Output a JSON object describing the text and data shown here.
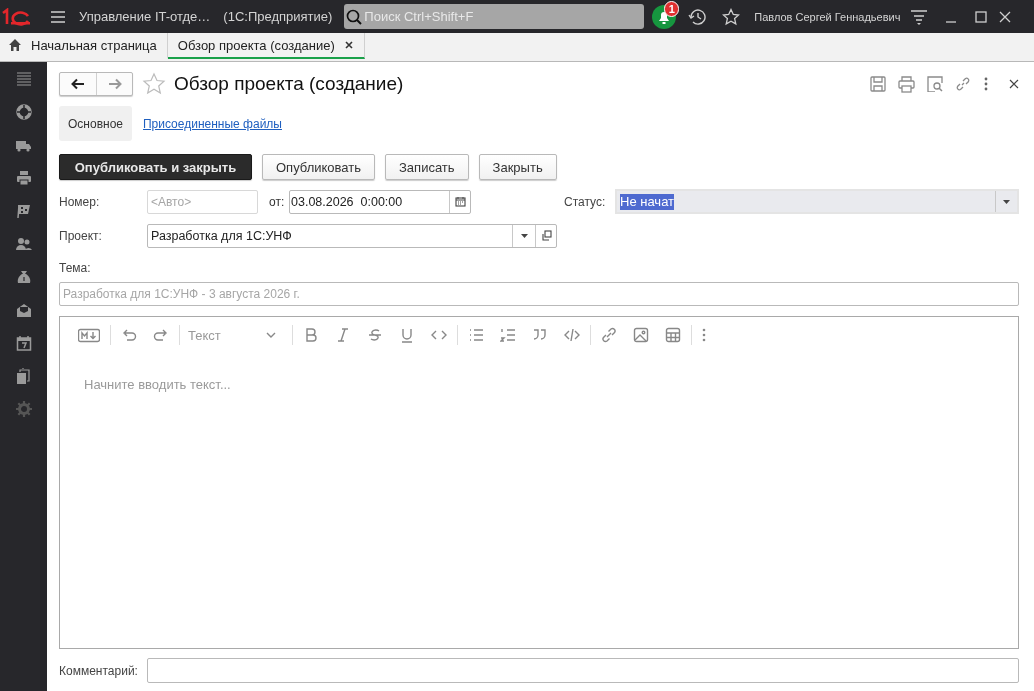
{
  "top_bar": {
    "app_title": "Управление IT-отде…",
    "platform": "(1С:Предприятие)",
    "search": {
      "placeholder": "Поиск Ctrl+Shift+F"
    },
    "notifications": {
      "count": "1"
    },
    "user": "Павлов Сергей Геннадьевич"
  },
  "tabs": [
    {
      "label": "Начальная страница",
      "kind": "home",
      "selected": false
    },
    {
      "label": "Обзор проекта (создание)",
      "kind": "document",
      "selected": true
    }
  ],
  "form": {
    "title": "Обзор проекта (создание)",
    "favorite": false,
    "tabs": [
      {
        "label": "Основное",
        "selected": true
      },
      {
        "label": "Присоединенные файлы",
        "selected": false
      }
    ],
    "buttons": [
      {
        "label": "Опубликовать и закрыть",
        "default": true
      },
      {
        "label": "Опубликовать",
        "default": false
      },
      {
        "label": "Записать",
        "default": false
      },
      {
        "label": "Закрыть",
        "default": false
      }
    ],
    "number": {
      "label": "Номер:",
      "placeholder": "<Авто>"
    },
    "date": {
      "label": "от:",
      "value": "03.08.2026  0:00:00"
    },
    "status": {
      "label": "Статус:",
      "value": "Не начат"
    },
    "project": {
      "label": "Проект:",
      "value": "Разработка для 1С:УНФ"
    },
    "topic": {
      "label": "Тема:",
      "placeholder": "Разработка для 1С:УНФ - 3 августа 2026 г."
    },
    "editor": {
      "format": "Текст",
      "placeholder": "Начните вводить текст..."
    },
    "comment": {
      "label": "Комментарий:"
    }
  }
}
